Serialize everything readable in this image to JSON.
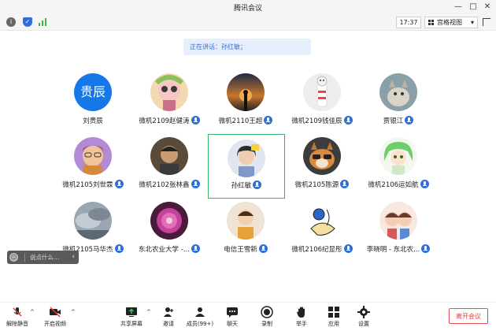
{
  "window": {
    "title": "腾讯会议",
    "minimize": "—",
    "maximize": "□",
    "close": "✕"
  },
  "top_toolbar": {
    "time": "17:37",
    "view_label": "宫格视图",
    "view_caret": "▾"
  },
  "speaker_banner": {
    "text": "正在讲话：孙红敏；"
  },
  "participants": [
    {
      "name": "刘贵辰",
      "avatar_text": "贵辰",
      "mic": false
    },
    {
      "name": "微机2109赵健涛",
      "mic": true
    },
    {
      "name": "微机2110王超",
      "mic": true
    },
    {
      "name": "微机2109钱佳辰",
      "mic": true
    },
    {
      "name": "贾银江",
      "mic": true
    },
    {
      "name": "微机2105刘世霖",
      "mic": true
    },
    {
      "name": "微机2102张林鑫",
      "mic": true
    },
    {
      "name": "孙红敏",
      "mic": true,
      "active": true
    },
    {
      "name": "微机2105陈源",
      "mic": true
    },
    {
      "name": "微机2106运如航",
      "mic": true
    },
    {
      "name": "微机2105马华杰",
      "mic": true
    },
    {
      "name": "东北农业大学 -...",
      "mic": true
    },
    {
      "name": "电信王雪新",
      "mic": true
    },
    {
      "name": "微机2106纪显彤",
      "mic": true
    },
    {
      "name": "李晓明 - 东北农...",
      "mic": true
    }
  ],
  "chat": {
    "placeholder": "说点什么...",
    "arrow": "‹",
    "smile": "☺"
  },
  "bottom_toolbar": {
    "unmute": "解除静音",
    "video": "开启视频",
    "share": "共享屏幕",
    "invite": "邀请",
    "members": "成员(99+)",
    "chat": "聊天",
    "record": "录制",
    "raise": "举手",
    "apps": "应用",
    "settings": "设置",
    "leave": "离开会议",
    "caret": "^"
  },
  "colors": {
    "accent_blue": "#2f6fdb",
    "active_border": "#35b36b",
    "leave_red": "#e04040"
  }
}
